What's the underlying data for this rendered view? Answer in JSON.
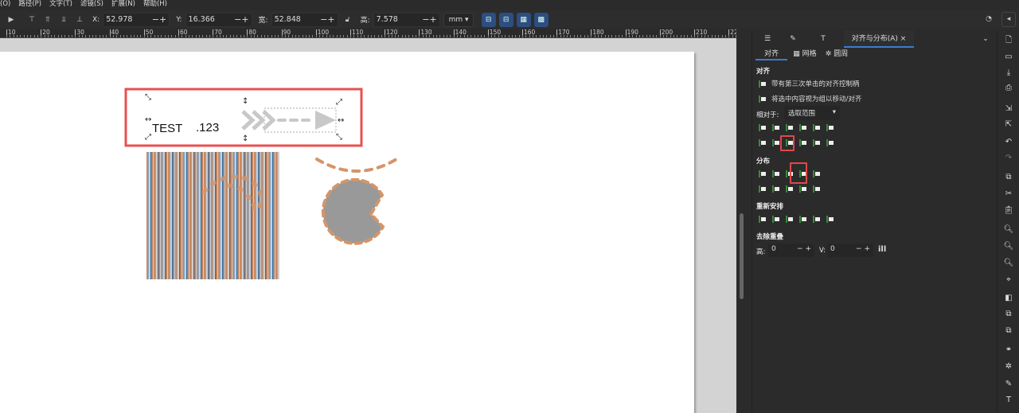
{
  "menu": [
    "(O)",
    "路径(P)",
    "文字(T)",
    "滤镜(S)",
    "扩展(N)",
    "帮助(H)"
  ],
  "toolbar": {
    "x_label": "X:",
    "x_value": "52.978",
    "y_label": "Y:",
    "y_value": "16.366",
    "w_label": "宽:",
    "w_value": "52.848",
    "h_label": "高:",
    "h_value": "7.578",
    "unit": "mm",
    "minus": "−",
    "plus": "+"
  },
  "ruler": {
    "labels": [
      "10",
      "20",
      "30",
      "40",
      "50",
      "60",
      "70",
      "80",
      "90",
      "100",
      "110",
      "120",
      "130",
      "140",
      "150",
      "160",
      "170",
      "180",
      "190",
      "200",
      "210",
      "22"
    ]
  },
  "canvas": {
    "text1": "TEST",
    "text2": ".123",
    "accent": "#e85050",
    "stroke": "#d4956a",
    "fill": "#999999"
  },
  "panel": {
    "tabs": [
      {
        "label": "对齐与分布(A)"
      }
    ],
    "close": "×",
    "subtabs": [
      "对齐",
      "网格",
      "圆周"
    ],
    "align_title": "对齐",
    "opt1": "带有第三次单击的对齐控制柄",
    "opt2": "将选中内容视为组以移动/对齐",
    "relative_label": "相对于:",
    "relative_value": "选取范围",
    "distribute_title": "分布",
    "rearrange_title": "重新安排",
    "overlap_title": "去除重叠",
    "h_label": "高:",
    "h_value": "0",
    "v_label": "V:",
    "v_value": "0"
  }
}
